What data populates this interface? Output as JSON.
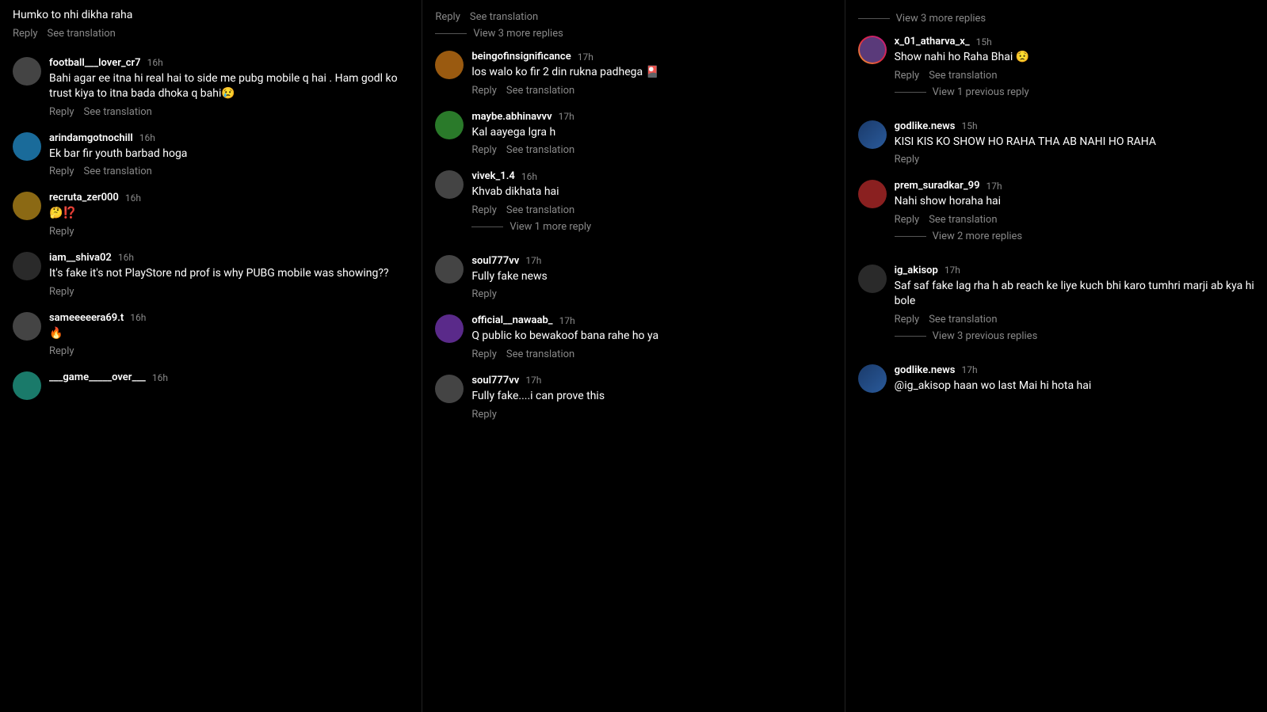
{
  "left_column": {
    "top_partial": {
      "text": "Humko to nhi dikha raha",
      "actions": [
        "Reply",
        "See translation"
      ]
    },
    "comments": [
      {
        "username": "football___lover_cr7",
        "time": "16h",
        "text": "Bahi agar ee itna hi real hai to side me pubg mobile q hai . Ham godl ko trust kiya to itna bada dhoka q bahi😢",
        "actions": [
          "Reply",
          "See translation"
        ]
      },
      {
        "username": "arindamgotnochill",
        "time": "16h",
        "text": "Ek bar fir youth barbad hoga",
        "actions": [
          "Reply",
          "See translation"
        ]
      },
      {
        "username": "recruta_zer000",
        "time": "16h",
        "text": "🤔⁉️",
        "actions": [
          "Reply"
        ]
      },
      {
        "username": "iam__shiva02",
        "time": "16h",
        "text": "It's fake it's not PlayStore nd prof is why PUBG mobile was showing??",
        "actions": [
          "Reply"
        ]
      },
      {
        "username": "sameeeeera69.t",
        "time": "16h",
        "text": "🔥",
        "actions": [
          "Reply"
        ]
      },
      {
        "username": "___game_____over___",
        "time": "16h",
        "text": "",
        "actions": []
      }
    ]
  },
  "middle_column": {
    "top_partial": {
      "actions": [
        "Reply",
        "See translation"
      ],
      "view_more": "View 3 more replies"
    },
    "comments": [
      {
        "username": "beingofinsignificance",
        "time": "17h",
        "text": "los walo ko fir 2 din rukna padhega 🎴",
        "actions": [
          "Reply",
          "See translation"
        ]
      },
      {
        "username": "maybe.abhinavvv",
        "time": "17h",
        "text": "Kal aayega lgra h",
        "actions": [
          "Reply",
          "See translation"
        ]
      },
      {
        "username": "vivek_1.4",
        "time": "16h",
        "text": "Khvab dikhata hai",
        "actions": [
          "Reply",
          "See translation"
        ],
        "view_reply": "View 1 more reply"
      },
      {
        "username": "soul777vv",
        "time": "17h",
        "text": "Fully fake news",
        "actions": [
          "Reply"
        ]
      },
      {
        "username": "official__nawaab_",
        "time": "17h",
        "text": "Q public ko bewakoof bana rahe ho ya",
        "actions": [
          "Reply",
          "See translation"
        ]
      },
      {
        "username": "soul777vv",
        "time": "17h",
        "text": "Fully fake....i can prove this",
        "actions": [
          "Reply"
        ]
      }
    ]
  },
  "right_column": {
    "top_partial": {
      "view_more": "View 3 more replies"
    },
    "comments": [
      {
        "username": "x_01_atharva_x_",
        "time": "15h",
        "text": "Show nahi ho Raha Bhai 😟",
        "actions": [
          "Reply",
          "See translation"
        ],
        "view_reply": "View 1 previous reply"
      },
      {
        "username": "godlike.news",
        "time": "15h",
        "text": "KISI KIS KO SHOW HO RAHA THA AB NAHI HO RAHA",
        "actions": [
          "Reply"
        ],
        "is_godlike": true
      },
      {
        "username": "prem_suradkar_99",
        "time": "17h",
        "text": "Nahi show horaha hai",
        "actions": [
          "Reply",
          "See translation"
        ],
        "view_reply": "View 2 more replies"
      },
      {
        "username": "ig_akisop",
        "time": "17h",
        "text": "Saf saf fake lag rha h ab reach ke liye kuch bhi karo tumhri marji ab kya hi bole",
        "actions": [
          "Reply",
          "See translation"
        ],
        "view_reply": "View 3 previous replies"
      },
      {
        "username": "godlike.news",
        "time": "17h",
        "text": "@ig_akisop haan wo last Mai hi hota hai",
        "actions": [],
        "is_godlike": true
      }
    ]
  }
}
